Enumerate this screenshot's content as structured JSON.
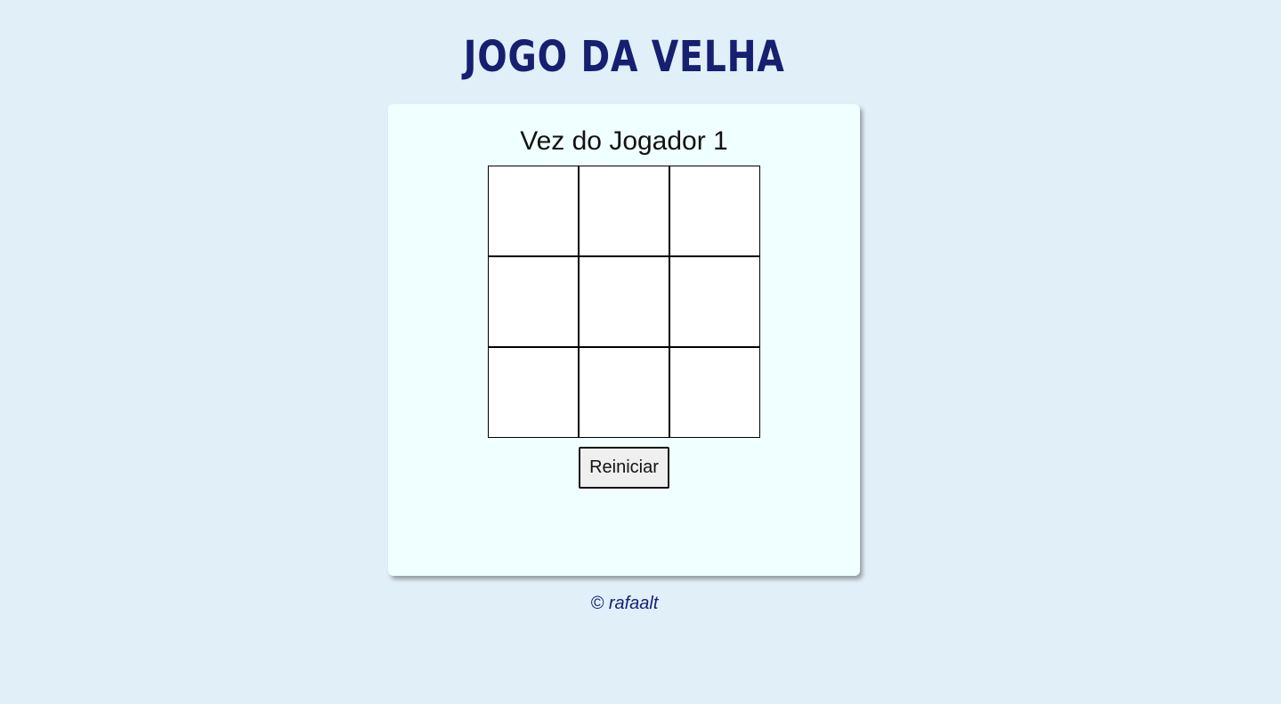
{
  "header": {
    "title": "JOGO DA VELHA"
  },
  "game": {
    "status": "Vez do Jogador 1",
    "board": [
      "",
      "",
      "",
      "",
      "",
      "",
      "",
      "",
      ""
    ],
    "reset_label": "Reiniciar"
  },
  "footer": {
    "credit": "© rafaalt"
  },
  "colors": {
    "background": "#e1eff9",
    "card": "#f0ffff",
    "title": "#161f70",
    "cell": "#ffffff"
  }
}
